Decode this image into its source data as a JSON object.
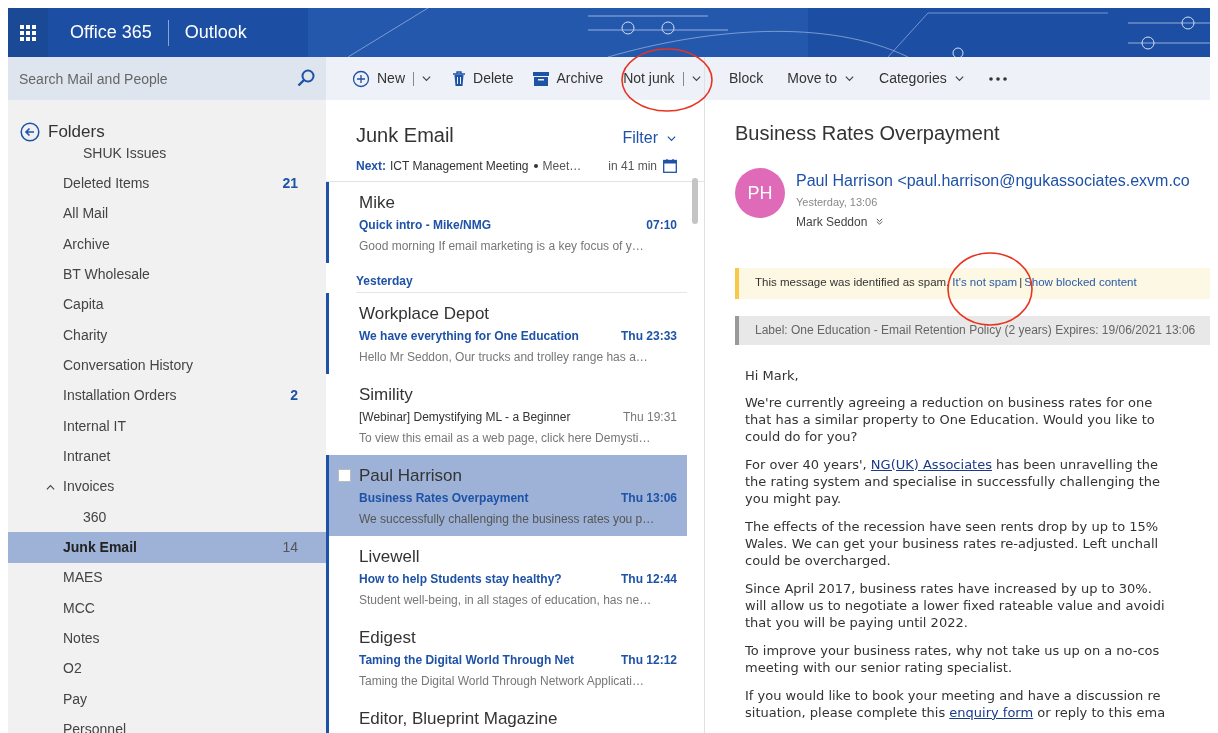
{
  "header": {
    "app_suite": "Office 365",
    "app_name": "Outlook"
  },
  "search": {
    "placeholder": "Search Mail and People"
  },
  "toolbar": [
    {
      "kind": "new",
      "label": "New"
    },
    {
      "kind": "delete",
      "label": "Delete"
    },
    {
      "kind": "archive",
      "label": "Archive"
    },
    {
      "kind": "split",
      "label": "Not junk"
    },
    {
      "kind": "plain",
      "label": "Block"
    },
    {
      "kind": "menu",
      "label": "Move to"
    },
    {
      "kind": "menu",
      "label": "Categories"
    },
    {
      "kind": "more"
    }
  ],
  "folders": {
    "title": "Folders",
    "items": [
      {
        "kind": "subfolder",
        "name": "SHUK Issues",
        "selected": false
      },
      {
        "kind": "folder",
        "name": "Deleted Items",
        "count": "21",
        "selected": false
      },
      {
        "kind": "folder",
        "name": "All Mail",
        "selected": false
      },
      {
        "kind": "folder",
        "name": "Archive",
        "selected": false
      },
      {
        "kind": "folder",
        "name": "BT Wholesale",
        "selected": false
      },
      {
        "kind": "folder",
        "name": "Capita",
        "selected": false
      },
      {
        "kind": "folder",
        "name": "Charity",
        "selected": false
      },
      {
        "kind": "folder",
        "name": "Conversation History",
        "selected": false
      },
      {
        "kind": "folder",
        "name": "Installation Orders",
        "count": "2",
        "selected": false
      },
      {
        "kind": "folder",
        "name": "Internal IT",
        "selected": false
      },
      {
        "kind": "folder",
        "name": "Intranet",
        "selected": false
      },
      {
        "kind": "folder",
        "name": "Invoices",
        "selected": false,
        "expanded": true,
        "children": [
          {
            "name": "360",
            "selected": false
          }
        ]
      },
      {
        "kind": "folder",
        "name": "Junk Email",
        "count": "14",
        "selected": true
      },
      {
        "kind": "folder",
        "name": "MAES",
        "selected": false
      },
      {
        "kind": "folder",
        "name": "MCC",
        "selected": false
      },
      {
        "kind": "folder",
        "name": "Notes",
        "selected": false
      },
      {
        "kind": "folder",
        "name": "O2",
        "selected": false
      },
      {
        "kind": "folder",
        "name": "Pay",
        "selected": false
      },
      {
        "kind": "folder",
        "name": "Personnel",
        "selected": false
      }
    ]
  },
  "message_list": {
    "title": "Junk Email",
    "filter": "Filter",
    "next": {
      "label": "Next:",
      "event": "ICT Management Meeting",
      "location": "Meet…",
      "time": "in 41 min"
    },
    "items": [
      {
        "kind": "message",
        "sender": "Mike",
        "subject": "Quick intro - Mike/NMG",
        "time": "07:10",
        "preview": "Good morning   If email marketing is a key focus of y…",
        "unread": true,
        "selected": false
      },
      {
        "kind": "group",
        "label": "Yesterday"
      },
      {
        "kind": "message",
        "sender": "Workplace Depot",
        "subject": "We have everything for One Education",
        "time": "Thu 23:33",
        "preview": "Hello Mr Seddon,  Our trucks and trolley range has a…",
        "unread": true,
        "selected": false
      },
      {
        "kind": "message",
        "sender": "Simility",
        "subject": "[Webinar] Demystifying ML - a Beginner",
        "time": "Thu 19:31",
        "preview": "To view this email as a web page, click here   Demysti…",
        "unread": false,
        "selected": false
      },
      {
        "kind": "message",
        "sender": "Paul Harrison",
        "subject": "Business Rates Overpayment",
        "time": "Thu 13:06",
        "preview": "We successfully challenging the business rates you p…",
        "unread": true,
        "selected": true
      },
      {
        "kind": "message",
        "sender": "Livewell",
        "subject": "How to help Students stay healthy?",
        "time": "Thu 12:44",
        "preview": "Student well-being, in all stages of education, has ne…",
        "unread": true,
        "selected": false
      },
      {
        "kind": "message",
        "sender": "Edigest",
        "subject": "Taming the Digital World Through Net",
        "time": "Thu 12:12",
        "preview": "Taming the Digital World Through Network Applicati…",
        "unread": true,
        "selected": false
      },
      {
        "kind": "message",
        "sender": "Editor, Blueprint Magazine",
        "unread": true,
        "selected": false
      }
    ]
  },
  "reading_pane": {
    "subject": "Business Rates Overpayment",
    "avatar": "PH",
    "from": "Paul Harrison <paul.harrison@ngukassociates.exvm.co",
    "date": "Yesterday, 13:06",
    "to": "Mark Seddon",
    "spam_notice": {
      "text": "This message was identified as spam.",
      "link": "It's not spam",
      "separator": "|",
      "link_2": "Show blocked content"
    },
    "label": "Label: One Education - Email Retention Policy (2 years) Expires: 19/06/2021 13:06",
    "greeting": "Hi Mark,",
    "paragraphs": [
      [
        {
          "text": "We're currently agreeing a reduction on business rates for one"
        },
        {
          "text": "that has a similar property to One Education. Would you like to"
        },
        {
          "text": "could do for you?"
        }
      ],
      [
        {
          "text": "For over 40 years', ",
          "link": "NG(UK) Associates",
          "after": " has been unravelling the"
        },
        {
          "text": "the rating system and specialise in successfully challenging the"
        },
        {
          "text": "you might pay."
        }
      ],
      [
        {
          "text": "The effects of the recession have seen rents drop by up to 15%"
        },
        {
          "text": "Wales. We can get your business rates re-adjusted. Left unchall"
        },
        {
          "text": "could be overcharged."
        }
      ],
      [
        {
          "text": "Since April 2017, business rates have increased by up to 30%."
        },
        {
          "text": "will allow us to negotiate a lower fixed rateable value and avoidi"
        },
        {
          "text": "that you will be paying until 2022."
        }
      ],
      [
        {
          "text": "To improve your business rates, why not take us up on a no-cos"
        },
        {
          "text": "meeting with our senior rating specialist."
        }
      ],
      [
        {
          "text": "If you would like to book your meeting and have a discussion re"
        },
        {
          "text": "situation, please complete this ",
          "link": "enquiry form",
          "after": " or reply to this ema"
        }
      ]
    ]
  }
}
